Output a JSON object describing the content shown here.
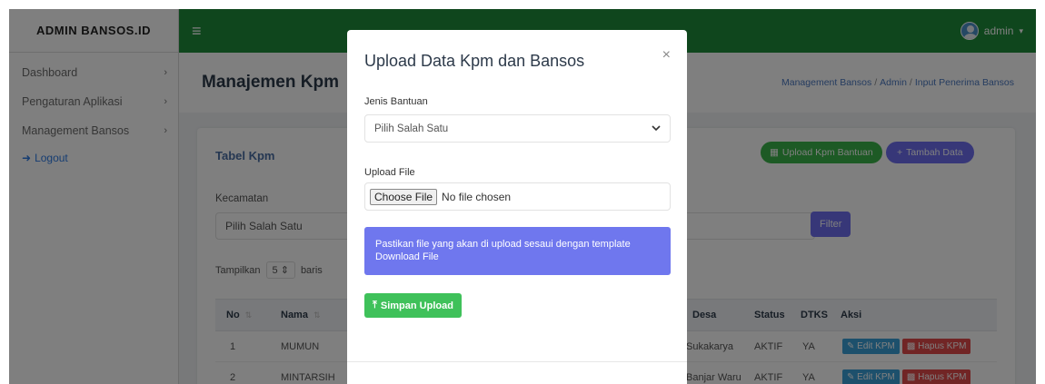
{
  "sidebar": {
    "brand": "ADMIN BANSOS.ID",
    "items": [
      {
        "label": "Dashboard",
        "chevron": "›"
      },
      {
        "label": "Pengaturan Aplikasi",
        "chevron": "›"
      },
      {
        "label": "Management Bansos",
        "chevron": "›"
      }
    ],
    "logout": "Logout"
  },
  "topbar": {
    "menu_glyph": "≡",
    "user": "admin",
    "caret": "▾",
    "color": "#1e8c3a"
  },
  "page": {
    "title": "Manajemen Kpm",
    "breadcrumb": [
      "Management Bansos",
      "Admin",
      "Input Penerima Bansos"
    ],
    "breadcrumb_sep": "/"
  },
  "card": {
    "title": "Tabel Kpm",
    "upload_button": "Upload Kpm Bantuan",
    "add_button": "Tambah Data",
    "kecamatan_label": "Kecamatan",
    "kecamatan_value": "Pilih Salah Satu",
    "filter_button": "Filter",
    "show_label": "Tampilkan",
    "page_size": "5",
    "rows_label": "baris"
  },
  "table": {
    "headers": {
      "no": "No",
      "nama": "Nama",
      "desa": "Desa",
      "status": "Status",
      "dtks": "DTKS",
      "aksi": "Aksi"
    },
    "rows": [
      {
        "no": "1",
        "nama": "MUMUN",
        "desa": "Sukakarya",
        "status": "AKTIF",
        "dtks": "YA"
      },
      {
        "no": "2",
        "nama": "MINTARSIH",
        "desa": "Banjar Waru",
        "status": "AKTIF",
        "dtks": "YA"
      }
    ],
    "edit_label": "Edit KPM",
    "delete_label": "Hapus KPM"
  },
  "modal": {
    "title": "Upload Data Kpm dan Bansos",
    "close": "×",
    "jenis_label": "Jenis Bantuan",
    "jenis_value": "Pilih Salah Satu",
    "file_label": "Upload File",
    "choose_button": "Choose File",
    "file_status": "No file chosen",
    "alert_line1": "Pastikan file yang akan di upload sesaui dengan template",
    "alert_line2": "Download File",
    "save_button": "Simpan Upload"
  }
}
